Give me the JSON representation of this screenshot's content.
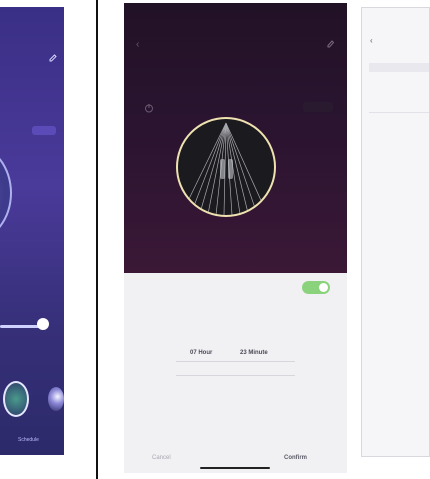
{
  "panel_a": {
    "status_text": "",
    "tabs": [
      "",
      ""
    ],
    "chip_label": "",
    "slider": {
      "value_fraction": 0.55,
      "value_text": ""
    },
    "thumb_label": "",
    "schedule_label": "Schedule",
    "accent": "#4a3a9a"
  },
  "panel_b": {
    "title": "",
    "tabs": [
      "",
      "",
      "",
      "",
      ""
    ],
    "btn_label": "",
    "scene_label": "",
    "sheet_title": "",
    "toggle_on": true,
    "picker_hours": [
      "",
      "",
      "07 Hour",
      "",
      ""
    ],
    "picker_minutes": [
      "",
      "",
      "23 Minute",
      "",
      ""
    ],
    "cancel_label": "Cancel",
    "confirm_label": "Confirm",
    "colors": {
      "sheet": "#f1f1f4",
      "toggle": "#8bd27c",
      "dark": "#1e1022"
    }
  },
  "panel_c": {
    "title": "",
    "search_placeholder": "",
    "item_time": "",
    "item_detail": ""
  }
}
